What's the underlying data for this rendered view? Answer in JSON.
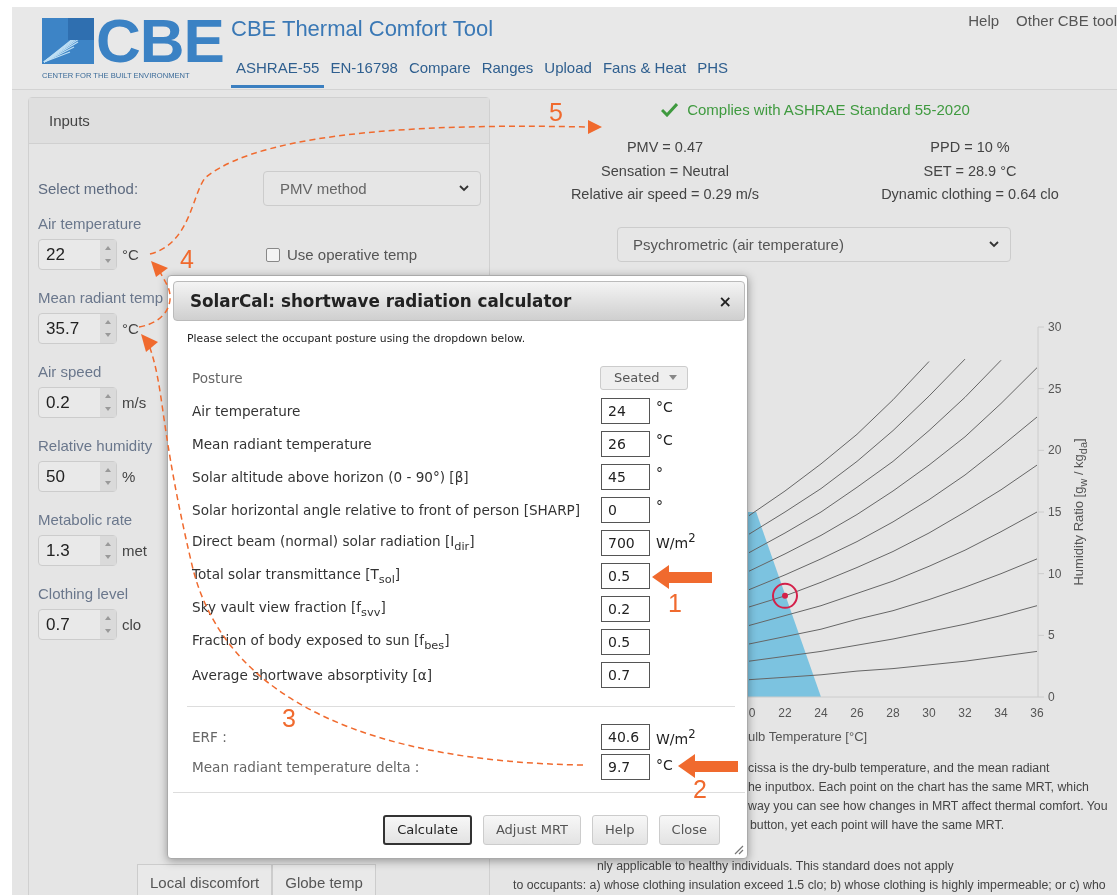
{
  "header": {
    "logo_text": "CBE",
    "logo_caption": "CENTER FOR THE BUILT ENVIRONMENT",
    "title": "CBE Thermal Comfort Tool",
    "tabs": [
      {
        "label": "ASHRAE-55",
        "selected": true
      },
      {
        "label": "EN-16798",
        "selected": false
      },
      {
        "label": "Compare",
        "selected": false
      },
      {
        "label": "Ranges",
        "selected": false
      },
      {
        "label": "Upload",
        "selected": false
      },
      {
        "label": "Fans & Heat",
        "selected": false
      },
      {
        "label": "PHS",
        "selected": false
      }
    ],
    "links": [
      "Help",
      "Other CBE tool"
    ]
  },
  "inputs": {
    "title": "Inputs",
    "method_label": "Select method:",
    "method": "PMV method",
    "operative_checkbox": {
      "label": "Use operative temp",
      "checked": false
    },
    "fields": [
      {
        "label": "Air temperature",
        "value": "22",
        "unit": "°C"
      },
      {
        "label": "Mean radiant temp",
        "value": "35.7",
        "unit": "°C"
      },
      {
        "label": "Air speed",
        "value": "0.2",
        "unit": "m/s"
      },
      {
        "label": "Relative humidity",
        "value": "50",
        "unit": "%"
      },
      {
        "label": "Metabolic rate",
        "value": "1.3",
        "unit": "met"
      },
      {
        "label": "Clothing level",
        "value": "0.7",
        "unit": "clo"
      }
    ],
    "buttons": [
      "Local discomfort",
      "Globe temp"
    ]
  },
  "results": {
    "compliance": "Complies with ASHRAE Standard 55-2020",
    "complies": true,
    "metrics": [
      "PMV = 0.47",
      "PPD = 10 %",
      "Sensation = Neutral",
      "SET = 28.9 °C",
      "Relative air speed = 0.29 m/s",
      "Dynamic clothing = 0.64 clo"
    ],
    "chart_select": "Psychrometric (air temperature)",
    "chart_cut_tick": "0",
    "chart_data": {
      "type": "line",
      "xlabel": "ulb Temperature [°C]",
      "ylabel": "Humidity Ratio [g$_{w}$ / kg$_{da}$]",
      "x": [
        20,
        22,
        24,
        26,
        28,
        30,
        32,
        34,
        36
      ],
      "series": [
        {
          "color": "#666666",
          "values": [
            1.4,
            1.6,
            1.8,
            2.1,
            2.3,
            2.6,
            2.9,
            3.3,
            3.7
          ]
        },
        {
          "color": "#666666",
          "values": [
            2.9,
            3.3,
            3.7,
            4.2,
            4.7,
            5.3,
            5.9,
            6.6,
            7.4
          ]
        },
        {
          "color": "#666666",
          "values": [
            4.3,
            4.9,
            5.5,
            6.3,
            7.0,
            7.9,
            8.9,
            10.0,
            11.2
          ]
        },
        {
          "color": "#666666",
          "values": [
            5.8,
            6.6,
            7.4,
            8.4,
            9.4,
            10.6,
            11.9,
            13.4,
            15.0
          ]
        },
        {
          "color": "#666666",
          "values": [
            7.3,
            8.2,
            9.3,
            10.5,
            11.8,
            13.3,
            15.0,
            16.8,
            18.8
          ]
        },
        {
          "color": "#666666",
          "values": [
            8.7,
            9.9,
            11.2,
            12.6,
            14.2,
            16.0,
            18.0,
            20.3,
            22.7
          ]
        },
        {
          "color": "#666666",
          "values": [
            10.2,
            11.6,
            13.1,
            14.8,
            16.7,
            18.8,
            21.1,
            23.8,
            26.7
          ]
        },
        {
          "color": "#666666",
          "values": [
            11.7,
            13.3,
            15.0,
            17.0,
            19.1,
            21.6,
            24.3,
            27.3,
            null
          ]
        },
        {
          "color": "#666666",
          "values": [
            13.2,
            15.0,
            16.9,
            19.1,
            21.6,
            24.4,
            27.4,
            null,
            null
          ]
        },
        {
          "color": "#666666",
          "values": [
            14.7,
            16.7,
            18.9,
            21.3,
            24.1,
            27.2,
            null,
            null,
            null
          ]
        },
        {
          "color": "#d4204a",
          "marker": "circle",
          "values": [
            null,
            8.2,
            null,
            null,
            null,
            null,
            null,
            null,
            null
          ]
        }
      ],
      "xlim": [
        19.5,
        36
      ],
      "ylim": [
        0,
        30
      ],
      "xticks": [
        22,
        24,
        26,
        28,
        30,
        32,
        34,
        36
      ],
      "yticks": [
        0,
        5,
        10,
        15,
        20,
        25,
        30
      ]
    },
    "description": [
      "cissa is the dry-bulb temperature, and the mean radiant",
      "he inputbox. Each point on the chart has the same MRT, which",
      "way you can see how changes in MRT affect thermal comfort. You",
      "button, yet each point will have the same MRT.",
      "nly applicable to healthy individuals. This standard does not apply",
      "to occupants: a) whose clothing insulation exceed 1.5 clo; b) whose clothing is highly impermeable; or c) who"
    ]
  },
  "modal": {
    "title": "SolarCal: shortwave radiation calculator",
    "close": "×",
    "instruction": "Please select the occupant posture using the dropdown below.",
    "posture": {
      "label": "Posture",
      "value": "Seated"
    },
    "fields": [
      {
        "label": "Air temperature",
        "value": "24",
        "unit": "°C"
      },
      {
        "label": "Mean radiant temperature",
        "value": "26",
        "unit": "°C"
      },
      {
        "label": "Solar altitude above horizon (0 - 90°) [β]",
        "value": "45",
        "unit": "°"
      },
      {
        "label": "Solar horizontal angle relative to front of person [SHARP]",
        "value": "0",
        "unit": "°"
      },
      {
        "label": "Direct beam (normal) solar radiation [I$_{dir}$]",
        "value": "700",
        "unit": "W/m$^{2}$"
      },
      {
        "label": "Total solar transmittance [T$_{sol}$]",
        "value": "0.5"
      },
      {
        "label": "Sky vault view fraction [f$_{svv}$]",
        "value": "0.2"
      },
      {
        "label": "Fraction of body exposed to sun [f$_{bes}$]",
        "value": "0.5"
      },
      {
        "label": "Average shortwave absorptivity [α]",
        "value": "0.7"
      }
    ],
    "outputs": [
      {
        "label": "ERF :",
        "value": "40.6",
        "unit": "W/m$^{2}$"
      },
      {
        "label": "Mean radiant temperature delta :",
        "value": "9.7",
        "unit": "°C"
      }
    ],
    "buttons": [
      {
        "label": "Calculate",
        "focused": true
      },
      {
        "label": "Adjust MRT",
        "focused": false
      },
      {
        "label": "Help",
        "focused": false
      },
      {
        "label": "Close",
        "focused": false
      }
    ]
  },
  "annotations": [
    {
      "label": "1"
    },
    {
      "label": "2"
    },
    {
      "label": "3"
    },
    {
      "label": "4"
    },
    {
      "label": "5"
    }
  ]
}
